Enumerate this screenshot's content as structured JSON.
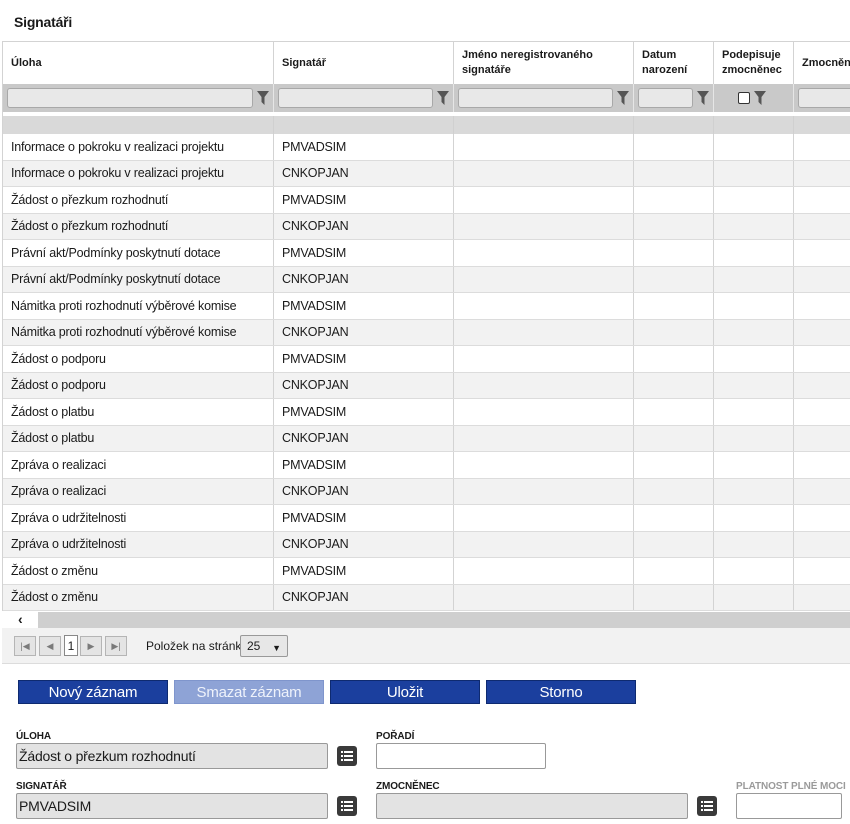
{
  "section_title": "Signatáři",
  "columns": [
    {
      "label": "Úloha"
    },
    {
      "label": "Signatář"
    },
    {
      "label": "Jméno neregistrovaného signatáře"
    },
    {
      "label": "Datum narození"
    },
    {
      "label": "Podepisuje zmocněnec"
    },
    {
      "label": "Zmocněnec"
    }
  ],
  "rows": [
    {
      "uloha": "Informace o pokroku v realizaci projektu",
      "signatar": "PMVADSIM"
    },
    {
      "uloha": "Informace o pokroku v realizaci projektu",
      "signatar": "CNKOPJAN"
    },
    {
      "uloha": "Žádost o přezkum rozhodnutí",
      "signatar": "PMVADSIM"
    },
    {
      "uloha": "Žádost o přezkum rozhodnutí",
      "signatar": "CNKOPJAN"
    },
    {
      "uloha": "Právní akt/Podmínky poskytnutí dotace",
      "signatar": "PMVADSIM"
    },
    {
      "uloha": "Právní akt/Podmínky poskytnutí dotace",
      "signatar": "CNKOPJAN"
    },
    {
      "uloha": "Námitka proti rozhodnutí výběrové komise",
      "signatar": "PMVADSIM"
    },
    {
      "uloha": "Námitka proti rozhodnutí výběrové komise",
      "signatar": "CNKOPJAN"
    },
    {
      "uloha": "Žádost o podporu",
      "signatar": "PMVADSIM"
    },
    {
      "uloha": "Žádost o podporu",
      "signatar": "CNKOPJAN"
    },
    {
      "uloha": "Žádost o platbu",
      "signatar": "PMVADSIM"
    },
    {
      "uloha": "Žádost o platbu",
      "signatar": "CNKOPJAN"
    },
    {
      "uloha": "Zpráva o realizaci",
      "signatar": "PMVADSIM"
    },
    {
      "uloha": "Zpráva o realizaci",
      "signatar": "CNKOPJAN"
    },
    {
      "uloha": "Zpráva o udržitelnosti",
      "signatar": "PMVADSIM"
    },
    {
      "uloha": "Zpráva o udržitelnosti",
      "signatar": "CNKOPJAN"
    },
    {
      "uloha": "Žádost o změnu",
      "signatar": "PMVADSIM"
    },
    {
      "uloha": "Žádost o změnu",
      "signatar": "CNKOPJAN"
    }
  ],
  "pager": {
    "current_page": "1",
    "per_page_label": "Položek na stránku",
    "per_page_value": "25"
  },
  "buttons": {
    "new": "Nový záznam",
    "delete": "Smazat záznam",
    "save": "Uložit",
    "cancel": "Storno"
  },
  "form": {
    "uloha_label": "ÚLOHA",
    "uloha_value": "Žádost o přezkum rozhodnutí",
    "poradi_label": "POŘADÍ",
    "poradi_value": "",
    "signatar_label": "SIGNATÁŘ",
    "signatar_value": "PMVADSIM",
    "zmocnenec_label": "ZMOCNĚNEC",
    "zmocnenec_value": "",
    "platnost_label": "PLATNOST PLNÉ MOCI",
    "platnost_value": ""
  },
  "colors": {
    "primary_button": "#1b3f9e",
    "disabled_button": "#8ea3d6",
    "filter_bar": "#c9c9c9"
  }
}
